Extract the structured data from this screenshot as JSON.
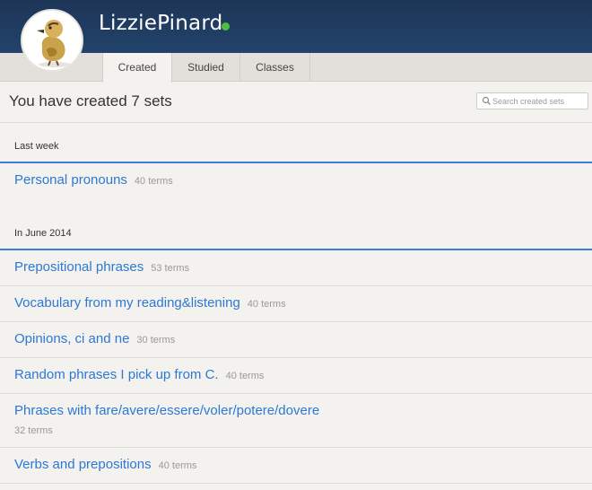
{
  "profile": {
    "username": "LizziePinard",
    "status_color": "#4fbf3c",
    "avatar_icon": "duckling-avatar"
  },
  "tabs": [
    {
      "label": "Created",
      "active": true
    },
    {
      "label": "Studied",
      "active": false
    },
    {
      "label": "Classes",
      "active": false
    }
  ],
  "main": {
    "title": "You have created 7 sets",
    "search_placeholder": "Search created sets"
  },
  "groups": [
    {
      "label": "Last week",
      "sets": [
        {
          "title": "Personal pronouns",
          "count": "40 terms"
        }
      ]
    },
    {
      "label": "In June 2014",
      "sets": [
        {
          "title": "Prepositional phrases",
          "count": "53 terms"
        },
        {
          "title": "Vocabulary from my reading&listening",
          "count": "40 terms"
        },
        {
          "title": "Opinions, ci and ne",
          "count": "30 terms"
        },
        {
          "title": "Random phrases I pick up from C.",
          "count": "40 terms"
        },
        {
          "title": "Phrases with fare/avere/essere/voler/potere/dovere",
          "count": "32 terms"
        },
        {
          "title": "Verbs and prepositions",
          "count": "40 terms"
        }
      ]
    }
  ],
  "colors": {
    "header": "#1c3557",
    "link": "#2c78d4",
    "divider_accent": "#3b7dd8"
  }
}
